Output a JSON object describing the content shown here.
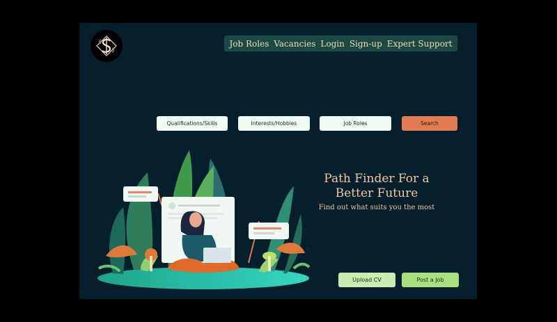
{
  "nav": {
    "items": [
      {
        "label": "Job Roles"
      },
      {
        "label": "Vacancies"
      },
      {
        "label": "Login"
      },
      {
        "label": "Sign-up"
      },
      {
        "label": "Expert Support"
      }
    ]
  },
  "filters": {
    "qualifications": "Qualifications/Skills",
    "interests": "Interests/Hobbies",
    "job_roles": "Job Roles",
    "search": "Search"
  },
  "hero": {
    "title_line1": "Path Finder For a",
    "title_line2": "Better Future",
    "subtitle": "Find out what suits you the most"
  },
  "actions": {
    "upload_cv": "Upload CV",
    "post_job": "Post a Job"
  },
  "colors": {
    "background": "#061f2c",
    "nav_bg": "#1b4a45",
    "nav_text": "#f0d9b8",
    "search": "#e27c55",
    "hero_text": "#f2c7a2",
    "upload": "#c7eeb1",
    "post": "#a9e07e"
  },
  "icons": {
    "logo": "ornate-dollar-logo-icon"
  }
}
